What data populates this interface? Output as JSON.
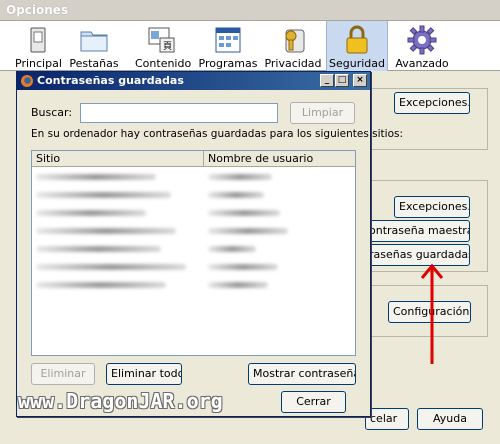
{
  "window": {
    "title": "Opciones"
  },
  "toolbar": {
    "tabs": [
      {
        "label": "Principal",
        "icon": "switch-icon"
      },
      {
        "label": "Pestañas",
        "icon": "folder-tabs-icon"
      },
      {
        "label": "Contenido",
        "icon": "content-icon"
      },
      {
        "label": "Programas",
        "icon": "applications-icon"
      },
      {
        "label": "Privacidad",
        "icon": "privacy-key-icon"
      },
      {
        "label": "Seguridad",
        "icon": "lock-icon",
        "active": true
      },
      {
        "label": "Avanzado",
        "icon": "gear-icon"
      }
    ]
  },
  "security": {
    "exceptions_button_1": "Excepciones...",
    "exceptions_button_2": "Excepciones...",
    "master_password_button": "ontraseña maestra...",
    "saved_passwords_button": "raseñas guardadas...",
    "configuration_button": "Configuración...",
    "cancel_button": "celar",
    "help_button": "Ayuda"
  },
  "dialog": {
    "title": "Contraseñas guardadas",
    "search_label": "Buscar:",
    "search_value": "",
    "clear_button": "Limpiar",
    "description": "En su ordenador hay contraseñas guardadas para los siguientes sitios:",
    "columns": {
      "site": "Sitio",
      "username": "Nombre de usuario"
    },
    "buttons": {
      "delete": "Eliminar",
      "delete_all": "Eliminar todos",
      "show_passwords": "Mostrar contraseñas",
      "close": "Cerrar"
    }
  },
  "watermark": "www.DragonJAR.org",
  "colors": {
    "title_bar": "#0a246a",
    "arrow": "#e00000",
    "active_tab": "#c9d9f0"
  }
}
